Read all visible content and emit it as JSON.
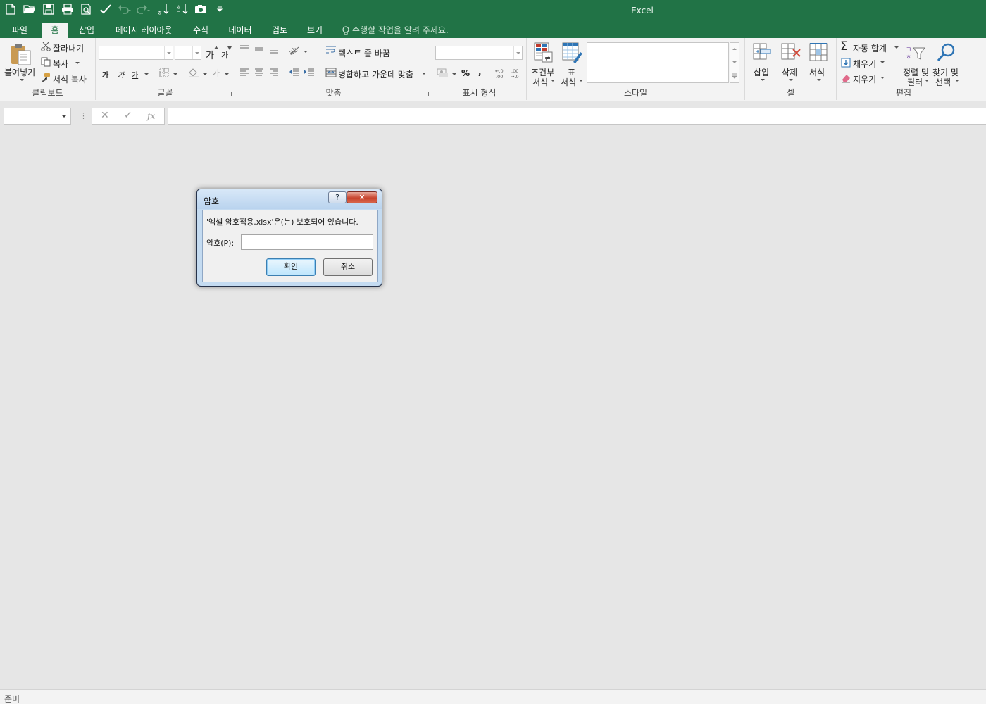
{
  "app": {
    "title": "Excel"
  },
  "qat": {
    "items": [
      "new-icon",
      "open-icon",
      "save-icon",
      "print-icon",
      "print-preview-icon",
      "spelling-icon",
      "undo-icon",
      "redo-icon",
      "sort-ascending-icon",
      "sort-descending-icon",
      "camera-icon",
      "customize-icon"
    ]
  },
  "tabs": [
    "파일",
    "홈",
    "삽입",
    "페이지 레이아웃",
    "수식",
    "데이터",
    "검토",
    "보기"
  ],
  "active_tab": "홈",
  "tell_me": "수행할 작업을 알려 주세요.",
  "ribbon": {
    "clipboard": {
      "paste": "붙여넣기",
      "cut": "잘라내기",
      "copy": "복사",
      "format_painter": "서식 복사",
      "label": "클립보드"
    },
    "font": {
      "font_name": "",
      "font_size": "",
      "grow": "가",
      "shrink": "가",
      "bold": "가",
      "italic": "가",
      "underline": "가",
      "font_color": "가",
      "label": "글꼴"
    },
    "alignment": {
      "wrap_text": "텍스트 줄 바꿈",
      "merge_center": "병합하고 가운데 맞춤",
      "label": "맞춤"
    },
    "number": {
      "format": "",
      "percent": "%",
      "comma": ",",
      "inc_decimal": "←.0 .00",
      "dec_decimal": ".00 →.0",
      "label": "표시 형식"
    },
    "styles": {
      "conditional": [
        "조건부",
        "서식"
      ],
      "table": [
        "표",
        "서식"
      ],
      "label": "스타일"
    },
    "cells": {
      "insert": "삽입",
      "delete": "삭제",
      "format": "서식",
      "label": "셀"
    },
    "editing": {
      "autosum": "자동 합계",
      "fill": "채우기",
      "clear": "지우기",
      "sort_filter": [
        "정렬 및",
        "필터"
      ],
      "find_select": [
        "찾기 및",
        "선택"
      ],
      "label": "편집"
    }
  },
  "formula_bar": {
    "name_box": "",
    "cancel": "✕",
    "enter": "✓",
    "fx": "fx",
    "content": ""
  },
  "dialog": {
    "title": "암호",
    "help": "?",
    "close": "✕",
    "message": "'엑셀 암호적용.xlsx'은(는) 보호되어 있습니다.",
    "password_label": "암호(P):",
    "password_value": "",
    "ok": "확인",
    "cancel": "취소"
  },
  "status": {
    "text": "준비"
  },
  "colors": {
    "brand": "#217346",
    "ribbon_bg": "#f3f3f3",
    "workspace_bg": "#e6e6e6"
  }
}
